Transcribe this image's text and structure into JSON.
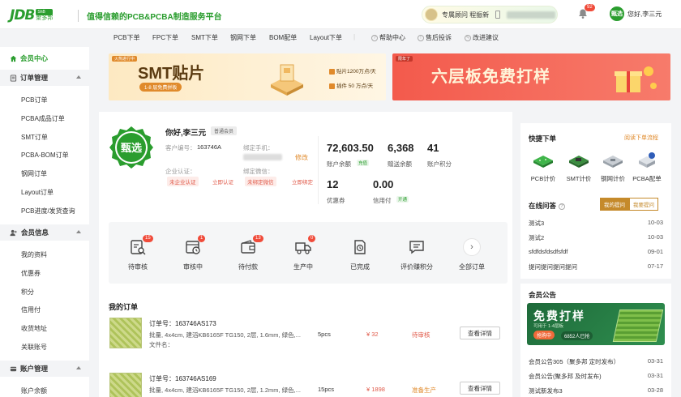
{
  "header": {
    "logo_main": "JDB",
    "logo_badge": "ShB",
    "logo_cn": "聚多邦",
    "slogan": "值得信赖的PCB&PCBA制造服务平台",
    "consultant": "专属顾问 程振新",
    "notification_count": "92",
    "user_avatar_text": "甄选",
    "user_greeting": "您好,李三元"
  },
  "nav": {
    "items": [
      "PCB下单",
      "FPC下单",
      "SMT下单",
      "钢网下单",
      "BOM配单",
      "Layout下单"
    ],
    "help": [
      "帮助中心",
      "售后投诉",
      "改进建议"
    ]
  },
  "sidebar": {
    "home": "会员中心",
    "sections": [
      {
        "title": "订单管理",
        "items": [
          "PCB订单",
          "PCBA成品订单",
          "SMT订单",
          "PCBA-BOM订单",
          "钢网订单",
          "Layout订单",
          "PCB进度/发货查询"
        ]
      },
      {
        "title": "会员信息",
        "items": [
          "我的资料",
          "优惠券",
          "积分",
          "信用付",
          "收货地址",
          "关联账号"
        ]
      },
      {
        "title": "账户管理",
        "items": [
          "账户余额"
        ]
      }
    ]
  },
  "banners": {
    "smt": {
      "tag": "火热进行中",
      "title": "SMT贴片",
      "subtitle": "1-8 层免费拼板",
      "line1": "贴片1200万点/天",
      "line2": "插件 50 万点/天"
    },
    "board": {
      "tag": "限年了",
      "title": "六层板免费打样"
    }
  },
  "profile": {
    "seal_text": "甄选",
    "greeting": "你好,李三元",
    "member_level": "普通会员",
    "customer_no_label": "客户编号：",
    "customer_no": "163746A",
    "phone_label": "绑定手机：",
    "modify": "修改",
    "enterprise_label": "企业认证：",
    "enterprise_status": "未企业认证",
    "enterprise_action": "立即认证",
    "wechat_label": "绑定微信：",
    "wechat_status": "未绑定微信",
    "wechat_action": "立即绑定"
  },
  "stats": {
    "balance": "72,603.50",
    "balance_label": "账户余额",
    "balance_action": "充值",
    "gift": "6,368",
    "gift_label": "赠送余额",
    "points": "41",
    "points_label": "账户积分",
    "coupons": "12",
    "coupons_label": "优惠券",
    "credit": "0.00",
    "credit_label": "信用付",
    "credit_action": "开通"
  },
  "order_status": [
    {
      "label": "待审核",
      "count": "15",
      "icon": "clipboard-search-icon"
    },
    {
      "label": "审核中",
      "count": "1",
      "icon": "calendar-clock-icon"
    },
    {
      "label": "待付款",
      "count": "13",
      "icon": "wallet-icon"
    },
    {
      "label": "生产中",
      "count": "0",
      "icon": "truck-icon"
    },
    {
      "label": "已完成",
      "count": "",
      "icon": "document-clock-icon"
    },
    {
      "label": "评价赚积分",
      "count": "",
      "icon": "chat-icon"
    },
    {
      "label": "全部订单",
      "count": "",
      "icon": "chevron-right-icon"
    }
  ],
  "orders": {
    "title": "我的订单",
    "rows": [
      {
        "no": "订单号：163746AS173",
        "desc": "批量, 4x4cm, 建滔KB6165F TG150, 2层, 1.6mm, 绿色,...",
        "file": "文件名：",
        "pcs": "5pcs",
        "price": "¥ 32",
        "status": "待审核",
        "action": "查看详情"
      },
      {
        "no": "订单号：163746AS169",
        "desc": "批量, 4x4cm, 建滔KB6165F TG150, 2层, 1.2mm, 绿色,...",
        "file": "",
        "pcs": "15pcs",
        "price": "¥ 1898",
        "status": "准备生产",
        "action": "查看详情"
      }
    ]
  },
  "quick_order": {
    "title": "快捷下单",
    "link": "阅读下单流程",
    "items": [
      "PCB计价",
      "SMT计价",
      "钢网计价",
      "PCBA配单"
    ]
  },
  "qa": {
    "title": "在线问答",
    "tab_active": "我的提问",
    "tab_inactive": "我要提问",
    "rows": [
      {
        "q": "测试3",
        "d": "10-03"
      },
      {
        "q": "测试2",
        "d": "10-03"
      },
      {
        "q": "sfdfdsfdsdfsfdf",
        "d": "09-01"
      },
      {
        "q": "提问提问提问提问",
        "d": "07-17"
      }
    ]
  },
  "announce": {
    "title": "会员公告",
    "banner_title": "免费打样",
    "banner_sub": "可用于 1-4层板",
    "banner_hot": "抢购中",
    "banner_count": "6852人已抢",
    "rows": [
      {
        "t": "会员公告305（聚多邦 定时发布）",
        "d": "03-31"
      },
      {
        "t": "会员公告(聚多邦 及时发布)",
        "d": "03-31"
      },
      {
        "t": "测试新发布3",
        "d": "03-28"
      }
    ]
  },
  "colors": {
    "brand": "#2a9d2e",
    "accent": "#e08a2b",
    "danger": "#e05a4a"
  }
}
